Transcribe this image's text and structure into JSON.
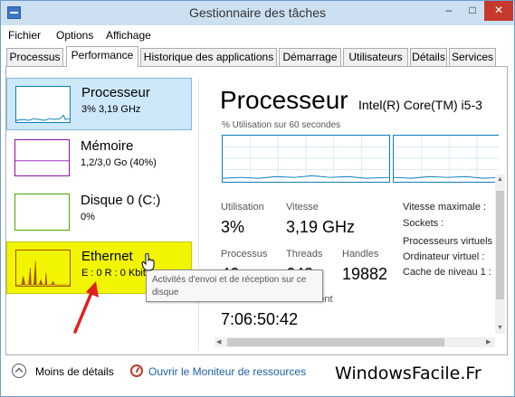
{
  "window": {
    "title": "Gestionnaire des tâches",
    "buttons": {
      "minimize": "–",
      "maximize": "□",
      "close": "✕"
    }
  },
  "menu": [
    "Fichier",
    "Options",
    "Affichage"
  ],
  "tabs": [
    {
      "label": "Processus"
    },
    {
      "label": "Performance",
      "active": true
    },
    {
      "label": "Historique des applications"
    },
    {
      "label": "Démarrage"
    },
    {
      "label": "Utilisateurs"
    },
    {
      "label": "Détails"
    },
    {
      "label": "Services"
    }
  ],
  "sidebar": {
    "items": [
      {
        "name": "Processeur",
        "value": "3% 3,19 GHz",
        "color": "#117dbb",
        "selected": true
      },
      {
        "name": "Mémoire",
        "value": "1,2/3,0 Go (40%)",
        "color": "#8b12ae"
      },
      {
        "name": "Disque 0 (C:)",
        "value": "0%",
        "color": "#4da60c"
      },
      {
        "name": "Ethernet",
        "value": "E : 0 R : 0 Kbit/s",
        "color": "#a74f01"
      }
    ]
  },
  "main": {
    "title": "Processeur",
    "model": "Intel(R) Core(TM) i5-3",
    "graph_caption": "% Utilisation sur 60 secondes",
    "stats": {
      "utilisation_label": "Utilisation",
      "utilisation_value": "3%",
      "vitesse_label": "Vitesse",
      "vitesse_value": "3,19 GHz",
      "processus_label": "Processus",
      "processus_value": "46",
      "threads_label": "Threads",
      "threads_value": "643",
      "handles_label": "Handles",
      "handles_value": "19882",
      "uptime_label": "Durée de fonctionnement",
      "uptime_value": "7:06:50:42"
    },
    "info": [
      "Vitesse maximale :",
      "Sockets :",
      "Processeurs virtuels",
      "Ordinateur virtuel :",
      "Cache de niveau 1 :"
    ]
  },
  "tooltip": {
    "text": "Activités d'envoi et de réception sur ce disque"
  },
  "footer": {
    "less_details": "Moins de détails",
    "resource_monitor": "Ouvrir le Moniteur de ressources"
  },
  "watermark": "WindowsFacile.Fr",
  "colors": {
    "accent_cpu": "#117dbb",
    "selected_bg": "#cde8f8",
    "highlight_yellow": "#f1f500",
    "close_button": "#c7392d",
    "annotation_arrow": "#e0201e"
  }
}
